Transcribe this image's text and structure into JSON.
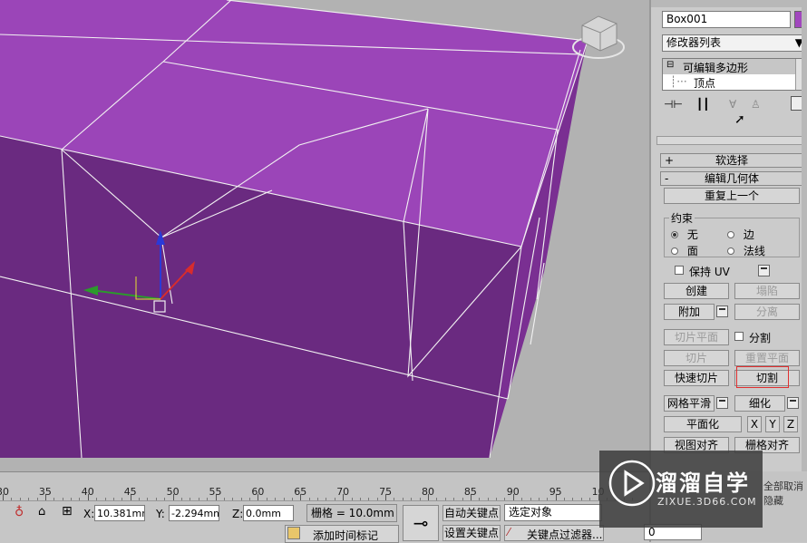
{
  "panel": {
    "object_name": "Box001",
    "modifier_list": "修改器列表",
    "stack": {
      "modifier": "可编辑多边形",
      "subobject": "顶点"
    },
    "rollouts": {
      "soft_select": "软选择",
      "edit_geometry": "编辑几何体"
    },
    "repeat_last": "重复上一个",
    "constraints": {
      "title": "约束",
      "none": "无",
      "edge": "边",
      "face": "面",
      "normal": "法线"
    },
    "preserve_uv": "保持 UV",
    "create": "创建",
    "collapse": "塌陷",
    "attach": "附加",
    "detach": "分离",
    "slice_plane": "切片平面",
    "split": "分割",
    "slice": "切片",
    "reset_plane": "重置平面",
    "quick_slice": "快速切片",
    "cut": "切割",
    "meshsmooth": "网格平滑",
    "tessellate": "细化",
    "planarize": "平面化",
    "x": "X",
    "y": "Y",
    "z": "Z",
    "view_align": "视图对齐",
    "grid_align": "栅格对齐",
    "hide_partial": "全部取消隐藏"
  },
  "timeline": {
    "ticks": [
      "30",
      "35",
      "40",
      "45",
      "50",
      "55",
      "60",
      "65",
      "70",
      "75",
      "80",
      "85",
      "90",
      "95",
      "10"
    ]
  },
  "status": {
    "x_label": "X:",
    "x_value": "10.381mm",
    "y_label": "Y:",
    "y_value": "-2.294mm",
    "z_label": "Z:",
    "z_value": "0.0mm",
    "grid": "栅格 = 10.0mm",
    "auto_key": "自动关键点",
    "selected": "选定对象",
    "set_key": "设置关键点",
    "key_filters": "关键点过滤器...",
    "add_time_tag": "添加时间标记",
    "frame": "0"
  },
  "watermark": {
    "title": "溜溜自学",
    "url": "ZIXUE.3D66.COM"
  },
  "colors": {
    "box_top": "#9b45b8",
    "box_front": "#6b2a82",
    "box_side": "#7c2f94",
    "cut_highlight": "#e03030"
  }
}
